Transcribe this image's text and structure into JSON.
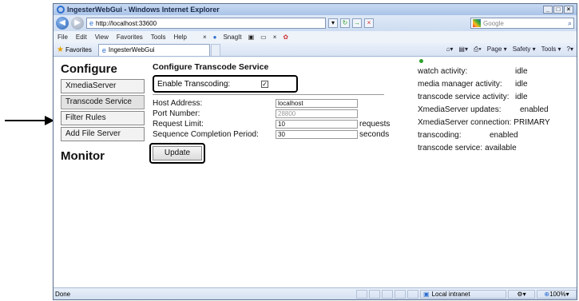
{
  "window": {
    "title": "IngesterWebGui - Windows Internet Explorer",
    "url": "http://localhost:33600",
    "search_placeholder": "Google",
    "menu": [
      "File",
      "Edit",
      "View",
      "Favorites",
      "Tools",
      "Help"
    ],
    "snagit_label": "SnagIt",
    "favorites_label": "Favorites",
    "tab_title": "IngesterWebGui",
    "command_bar": [
      "Page ▾",
      "Safety ▾",
      "Tools ▾"
    ]
  },
  "sidebar": {
    "configure_heading": "Configure",
    "items": [
      {
        "label": "XmediaServer"
      },
      {
        "label": "Transcode Service"
      },
      {
        "label": "Filter Rules"
      },
      {
        "label": "Add File Server"
      }
    ],
    "monitor_heading": "Monitor"
  },
  "form": {
    "title": "Configure Transcode Service",
    "enable_label": "Enable Transcoding:",
    "enable_checked": true,
    "fields": [
      {
        "label": "Host Address:",
        "value": "localhost",
        "unit": "",
        "disabled": false
      },
      {
        "label": "Port Number:",
        "value": "28800",
        "unit": "",
        "disabled": true
      },
      {
        "label": "Request Limit:",
        "value": "10",
        "unit": "requests",
        "disabled": false
      },
      {
        "label": "Sequence Completion Period:",
        "value": "30",
        "unit": "seconds",
        "disabled": false
      }
    ],
    "update_label": "Update"
  },
  "status": {
    "indicator_color": "#2ca02c",
    "rows": [
      {
        "key": "watch activity:",
        "value": "idle"
      },
      {
        "key": "media manager activity:",
        "value": "idle"
      },
      {
        "key": "transcode service activity:",
        "value": "idle"
      },
      {
        "key": "XmediaServer updates:",
        "value": "enabled"
      },
      {
        "key": "XmediaServer connection:",
        "value": "PRIMARY"
      },
      {
        "key": "transcoding:",
        "value": "enabled"
      },
      {
        "key": "transcode service:",
        "value": "available"
      }
    ]
  },
  "statusbar": {
    "done": "Done",
    "zone": "Local intranet",
    "zoom": "100%"
  }
}
